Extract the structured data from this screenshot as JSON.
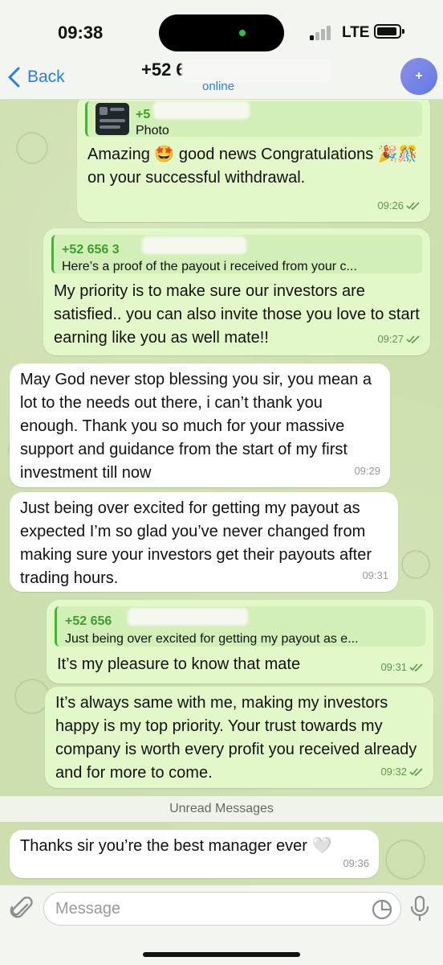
{
  "status": {
    "time": "09:38",
    "network": "LTE"
  },
  "header": {
    "back_label": "Back",
    "contact_name": "+52 65",
    "contact_status": "online",
    "avatar_glyph": "+"
  },
  "messages": [
    {
      "dir": "out",
      "quote_name": "+5",
      "quote_text": "Photo",
      "text": "Amazing 🤩 good news Congratulations 🎉🎊 on your successful withdrawal.",
      "time": "09:26"
    },
    {
      "dir": "out",
      "quote_name": "+52 656 3",
      "quote_text": "Here’s a proof of the payout i received from your c...",
      "text": "My priority is to make sure our investors are satisfied.. you can also invite those you love to start earning like you as well mate!!",
      "time": "09:27"
    },
    {
      "dir": "in",
      "text": "May God never stop blessing you sir, you mean a lot to the needs out there, i can’t thank you enough. Thank you so much for your massive support and guidance from the start of my first investment till now",
      "time": "09:29"
    },
    {
      "dir": "in",
      "text": "Just being over excited for getting my payout as expected I’m so glad you’ve never changed from making sure your investors get their payouts after trading hours.",
      "time": "09:31"
    },
    {
      "dir": "out",
      "quote_name": "+52 656",
      "quote_text": "Just being over excited for getting my payout as e...",
      "text": "It’s my pleasure to know that mate",
      "time": "09:31"
    },
    {
      "dir": "out",
      "text": "It’s always same with me, making my investors happy is my top priority. Your trust towards my company is worth every profit you received already and for more to come.",
      "time": "09:32"
    },
    {
      "dir": "in",
      "text": "Thanks sir you’re the best manager ever 🤍",
      "time": "09:36"
    }
  ],
  "divider": {
    "unread_label": "Unread Messages"
  },
  "composer": {
    "placeholder": "Message"
  },
  "colors": {
    "accent": "#2f7de1",
    "outgoing_bubble": "#e3f8c8",
    "incoming_bubble": "#ffffff",
    "quote_name": "#3d9e2e"
  },
  "icons": {
    "back": "chevron-left-icon",
    "attach": "paperclip-icon",
    "sticker": "sticker-icon",
    "mic": "microphone-icon",
    "read": "double-check-icon"
  }
}
